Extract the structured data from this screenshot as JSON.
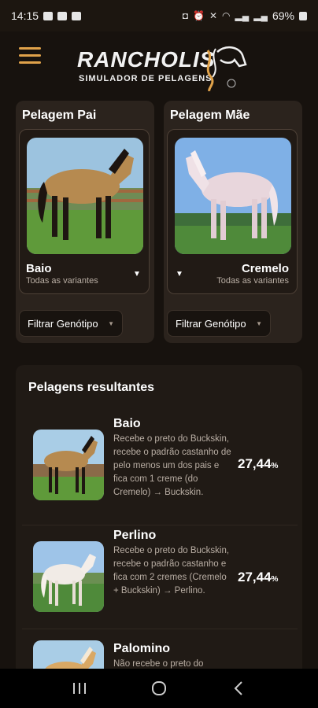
{
  "status_bar": {
    "time": "14:15",
    "battery": "69%"
  },
  "header": {
    "brand": "RANCHOLIS",
    "subtitle": "SIMULADOR DE PELAGENS"
  },
  "parents": {
    "father": {
      "title": "Pelagem Pai",
      "coat": "Baio",
      "variant": "Todas as variantes",
      "filter": "Filtrar Genótipo"
    },
    "mother": {
      "title": "Pelagem Mãe",
      "coat": "Cremelo",
      "variant": "Todas as variantes",
      "filter": "Filtrar Genótipo"
    }
  },
  "results": {
    "title": "Pelagens resultantes",
    "items": [
      {
        "name": "Baio",
        "description": "Recebe o preto do Buckskin, recebe o padrão castanho de pelo menos um dos pais e fica com 1 creme (do Cremelo) → Buckskin.",
        "percent": "27,44",
        "unit": "%"
      },
      {
        "name": "Perlino",
        "description": "Recebe o preto do Buckskin, recebe o padrão castanho e fica com 2 cremes (Cremelo + Buckskin) → Perlino.",
        "percent": "27,44",
        "unit": "%"
      },
      {
        "name": "Palomino",
        "description": "Não recebe o preto do",
        "percent": "",
        "unit": ""
      }
    ]
  },
  "colors": {
    "accent": "#e0a24a",
    "card": "#2b231d",
    "background": "#17120e"
  }
}
